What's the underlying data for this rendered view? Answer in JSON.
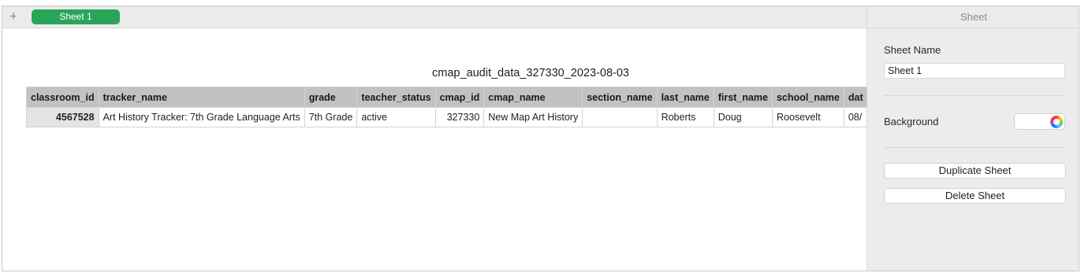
{
  "tabbar": {
    "add_label": "+",
    "active_sheet": "Sheet 1"
  },
  "table": {
    "title": "cmap_audit_data_327330_2023-08-03",
    "columns": [
      "classroom_id",
      "tracker_name",
      "grade",
      "teacher_status",
      "cmap_id",
      "cmap_name",
      "section_name",
      "last_name",
      "first_name",
      "school_name",
      "dat"
    ],
    "rows": [
      [
        "4567528",
        "Art History Tracker: 7th Grade Language Arts",
        "7th Grade",
        "active",
        "327330",
        "New Map Art History",
        "",
        "Roberts",
        "Doug",
        "Roosevelt",
        "08/"
      ]
    ]
  },
  "inspector": {
    "header": "Sheet",
    "sheet_name_label": "Sheet Name",
    "sheet_name_value": "Sheet 1",
    "background_label": "Background",
    "duplicate_label": "Duplicate Sheet",
    "delete_label": "Delete Sheet"
  },
  "colors": {
    "tab_active": "#29a55a",
    "header_bg": "#c2c2c2",
    "rowhead_bg": "#e4e4e4",
    "sidebar_bg": "#ececec"
  },
  "icons": [
    "plus-icon",
    "color-wheel-icon"
  ]
}
